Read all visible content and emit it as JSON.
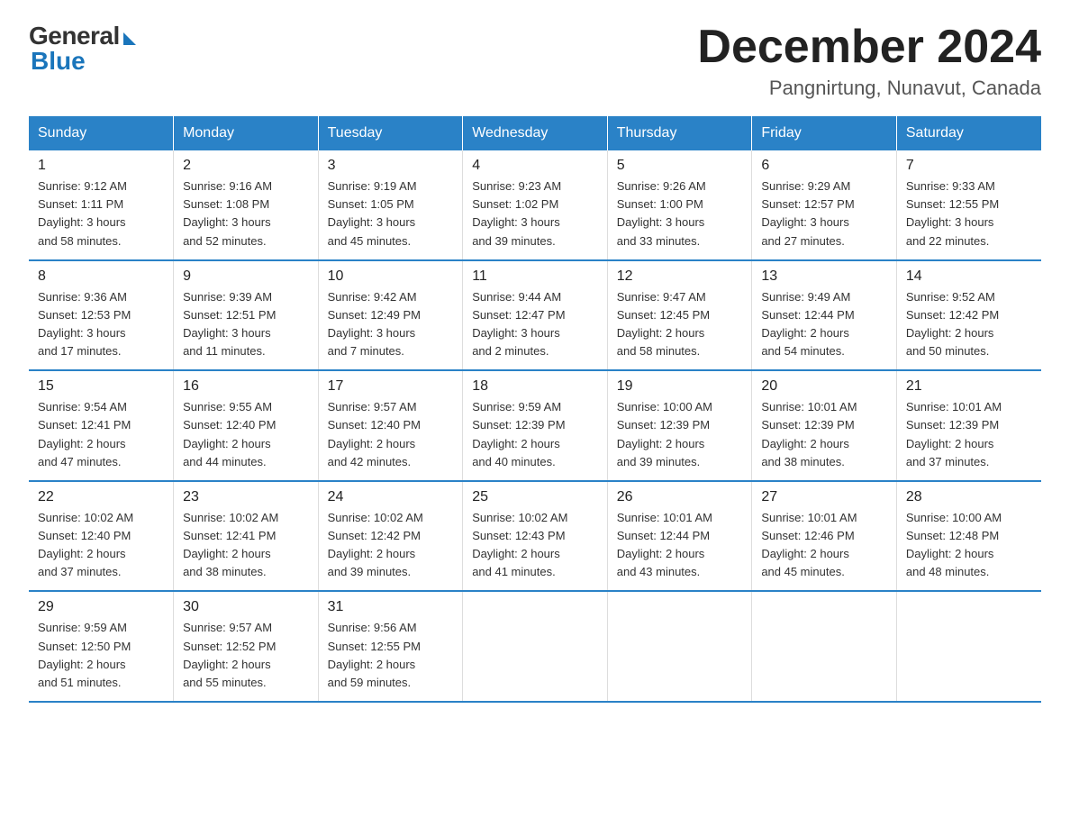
{
  "header": {
    "logo_general": "General",
    "logo_blue": "Blue",
    "month_year": "December 2024",
    "location": "Pangnirtung, Nunavut, Canada"
  },
  "days_of_week": [
    "Sunday",
    "Monday",
    "Tuesday",
    "Wednesday",
    "Thursday",
    "Friday",
    "Saturday"
  ],
  "weeks": [
    [
      {
        "day": "1",
        "info": "Sunrise: 9:12 AM\nSunset: 1:11 PM\nDaylight: 3 hours\nand 58 minutes."
      },
      {
        "day": "2",
        "info": "Sunrise: 9:16 AM\nSunset: 1:08 PM\nDaylight: 3 hours\nand 52 minutes."
      },
      {
        "day": "3",
        "info": "Sunrise: 9:19 AM\nSunset: 1:05 PM\nDaylight: 3 hours\nand 45 minutes."
      },
      {
        "day": "4",
        "info": "Sunrise: 9:23 AM\nSunset: 1:02 PM\nDaylight: 3 hours\nand 39 minutes."
      },
      {
        "day": "5",
        "info": "Sunrise: 9:26 AM\nSunset: 1:00 PM\nDaylight: 3 hours\nand 33 minutes."
      },
      {
        "day": "6",
        "info": "Sunrise: 9:29 AM\nSunset: 12:57 PM\nDaylight: 3 hours\nand 27 minutes."
      },
      {
        "day": "7",
        "info": "Sunrise: 9:33 AM\nSunset: 12:55 PM\nDaylight: 3 hours\nand 22 minutes."
      }
    ],
    [
      {
        "day": "8",
        "info": "Sunrise: 9:36 AM\nSunset: 12:53 PM\nDaylight: 3 hours\nand 17 minutes."
      },
      {
        "day": "9",
        "info": "Sunrise: 9:39 AM\nSunset: 12:51 PM\nDaylight: 3 hours\nand 11 minutes."
      },
      {
        "day": "10",
        "info": "Sunrise: 9:42 AM\nSunset: 12:49 PM\nDaylight: 3 hours\nand 7 minutes."
      },
      {
        "day": "11",
        "info": "Sunrise: 9:44 AM\nSunset: 12:47 PM\nDaylight: 3 hours\nand 2 minutes."
      },
      {
        "day": "12",
        "info": "Sunrise: 9:47 AM\nSunset: 12:45 PM\nDaylight: 2 hours\nand 58 minutes."
      },
      {
        "day": "13",
        "info": "Sunrise: 9:49 AM\nSunset: 12:44 PM\nDaylight: 2 hours\nand 54 minutes."
      },
      {
        "day": "14",
        "info": "Sunrise: 9:52 AM\nSunset: 12:42 PM\nDaylight: 2 hours\nand 50 minutes."
      }
    ],
    [
      {
        "day": "15",
        "info": "Sunrise: 9:54 AM\nSunset: 12:41 PM\nDaylight: 2 hours\nand 47 minutes."
      },
      {
        "day": "16",
        "info": "Sunrise: 9:55 AM\nSunset: 12:40 PM\nDaylight: 2 hours\nand 44 minutes."
      },
      {
        "day": "17",
        "info": "Sunrise: 9:57 AM\nSunset: 12:40 PM\nDaylight: 2 hours\nand 42 minutes."
      },
      {
        "day": "18",
        "info": "Sunrise: 9:59 AM\nSunset: 12:39 PM\nDaylight: 2 hours\nand 40 minutes."
      },
      {
        "day": "19",
        "info": "Sunrise: 10:00 AM\nSunset: 12:39 PM\nDaylight: 2 hours\nand 39 minutes."
      },
      {
        "day": "20",
        "info": "Sunrise: 10:01 AM\nSunset: 12:39 PM\nDaylight: 2 hours\nand 38 minutes."
      },
      {
        "day": "21",
        "info": "Sunrise: 10:01 AM\nSunset: 12:39 PM\nDaylight: 2 hours\nand 37 minutes."
      }
    ],
    [
      {
        "day": "22",
        "info": "Sunrise: 10:02 AM\nSunset: 12:40 PM\nDaylight: 2 hours\nand 37 minutes."
      },
      {
        "day": "23",
        "info": "Sunrise: 10:02 AM\nSunset: 12:41 PM\nDaylight: 2 hours\nand 38 minutes."
      },
      {
        "day": "24",
        "info": "Sunrise: 10:02 AM\nSunset: 12:42 PM\nDaylight: 2 hours\nand 39 minutes."
      },
      {
        "day": "25",
        "info": "Sunrise: 10:02 AM\nSunset: 12:43 PM\nDaylight: 2 hours\nand 41 minutes."
      },
      {
        "day": "26",
        "info": "Sunrise: 10:01 AM\nSunset: 12:44 PM\nDaylight: 2 hours\nand 43 minutes."
      },
      {
        "day": "27",
        "info": "Sunrise: 10:01 AM\nSunset: 12:46 PM\nDaylight: 2 hours\nand 45 minutes."
      },
      {
        "day": "28",
        "info": "Sunrise: 10:00 AM\nSunset: 12:48 PM\nDaylight: 2 hours\nand 48 minutes."
      }
    ],
    [
      {
        "day": "29",
        "info": "Sunrise: 9:59 AM\nSunset: 12:50 PM\nDaylight: 2 hours\nand 51 minutes."
      },
      {
        "day": "30",
        "info": "Sunrise: 9:57 AM\nSunset: 12:52 PM\nDaylight: 2 hours\nand 55 minutes."
      },
      {
        "day": "31",
        "info": "Sunrise: 9:56 AM\nSunset: 12:55 PM\nDaylight: 2 hours\nand 59 minutes."
      },
      {
        "day": "",
        "info": ""
      },
      {
        "day": "",
        "info": ""
      },
      {
        "day": "",
        "info": ""
      },
      {
        "day": "",
        "info": ""
      }
    ]
  ]
}
